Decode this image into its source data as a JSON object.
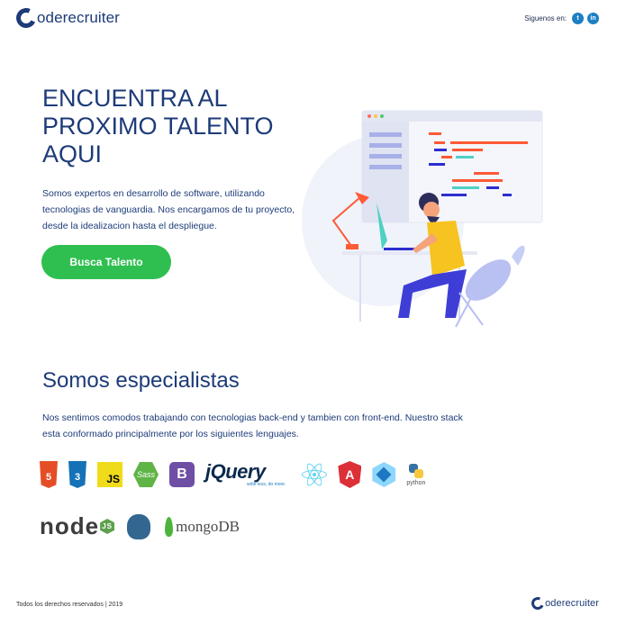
{
  "header": {
    "logo_text": "oderecruiter",
    "social_label": "Siguenos en:",
    "social": [
      {
        "icon": "twitter-icon",
        "glyph": "t"
      },
      {
        "icon": "linkedin-icon",
        "glyph": "in"
      }
    ]
  },
  "hero": {
    "title": "ENCUENTRA AL PROXIMO TALENTO AQUI",
    "description": "Somos expertos en desarrollo de software, utilizando tecnologias de vanguardia. Nos encargamos de tu proyecto, desde la idealizacion hasta el despliegue.",
    "cta_label": "Busca Talento"
  },
  "specialists": {
    "title": "Somos especialistas",
    "description": "Nos sentimos comodos trabajando con tecnologias back-end y tambien con front-end. Nuestro stack esta conformado principalmente por los siguientes lenguajes."
  },
  "technologies": {
    "html5": "5",
    "css3": "3",
    "js": "JS",
    "sass": "Sass",
    "bootstrap": "B",
    "jquery": "jQuery",
    "jquery_tagline": "write less, do more.",
    "angular": "A",
    "python": "python",
    "node": "node",
    "node_badge": "JS",
    "mongodb": "mongoDB"
  },
  "footer": {
    "rights": "Todos los derechos reservados | 2019",
    "logo_text": "oderecruiter"
  },
  "colors": {
    "brand": "#1d3b78",
    "cta": "#2fbf50",
    "social": "#1d7fc4"
  }
}
